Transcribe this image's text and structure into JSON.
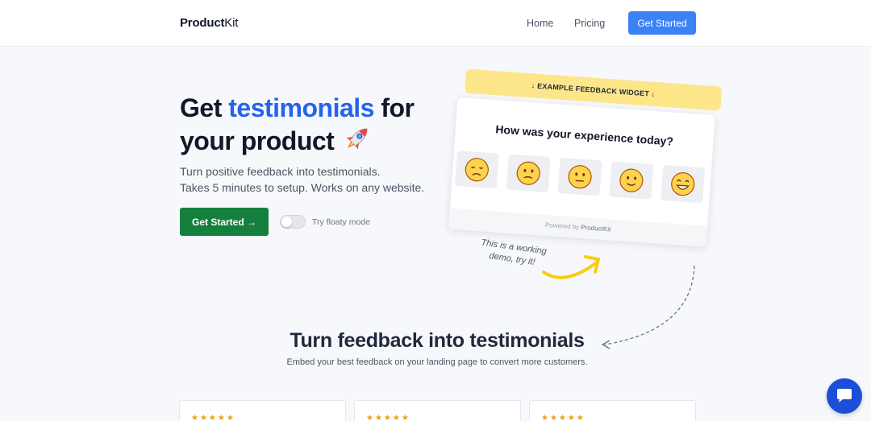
{
  "header": {
    "logo_bold": "Product",
    "logo_rest": "Kit",
    "nav_home": "Home",
    "nav_pricing": "Pricing",
    "cta_label": "Get Started"
  },
  "hero": {
    "title_part1": "Get ",
    "title_accent": "testimonials",
    "title_part2": " for your product",
    "subtitle_line1": "Turn positive feedback into testimonials.",
    "subtitle_line2": "Takes 5 minutes to setup. Works on any website.",
    "cta_label": "Get Started →",
    "toggle_label": "Try floaty mode",
    "toggle_on": false,
    "icon": "rocket-icon"
  },
  "widget": {
    "banner": "↓ EXAMPLE FEEDBACK WIDGET ↓",
    "question": "How was your experience today?",
    "emojis": [
      "sad-face-icon",
      "frowning-face-icon",
      "neutral-face-icon",
      "slightly-smiling-face-icon",
      "grinning-face-icon"
    ],
    "footer_prefix": "Powered by ",
    "footer_brand": "ProductKit"
  },
  "demo_note": {
    "line1": "This is a working",
    "line2": "demo, try it!"
  },
  "section": {
    "title": "Turn feedback into testimonials",
    "subtitle": "Embed your best feedback on your landing page to convert more customers."
  },
  "testimonial_cards": [
    {
      "stars": "★★★★★"
    },
    {
      "stars": "★★★★★"
    },
    {
      "stars": "★★★★★"
    }
  ],
  "colors": {
    "accent_blue": "#2563eb",
    "nav_button": "#3b82f6",
    "cta_green": "#15803d",
    "banner_yellow": "#fde68a",
    "arrow_yellow": "#facc15",
    "chat_blue": "#1d4ed8"
  },
  "chat_icon": "chat-bubble-icon"
}
